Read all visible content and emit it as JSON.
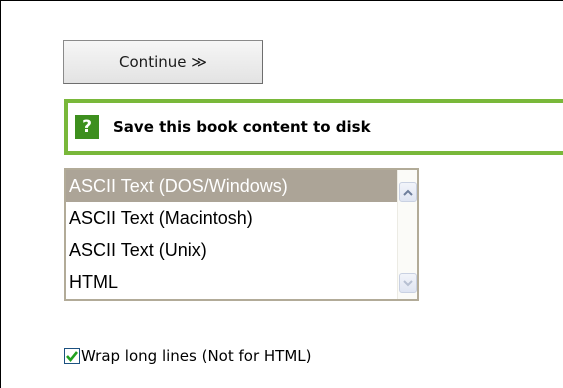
{
  "continue_button": {
    "label": "Continue ≫"
  },
  "save_section": {
    "icon_glyph": "?",
    "icon_name": "help-icon",
    "label": "Save this book content to disk",
    "accent_color": "#79b83a",
    "icon_color": "#3d8f1e"
  },
  "format_list": {
    "options": [
      "ASCII Text (DOS/Windows)",
      "ASCII Text (Macintosh)",
      "ASCII Text (Unix)",
      "HTML"
    ],
    "selected": "ASCII Text (DOS/Windows)",
    "selected_color": "#aca497"
  },
  "wrap_option": {
    "label": "Wrap long lines (Not for HTML)",
    "checked": true,
    "check_color": "#21a121"
  }
}
